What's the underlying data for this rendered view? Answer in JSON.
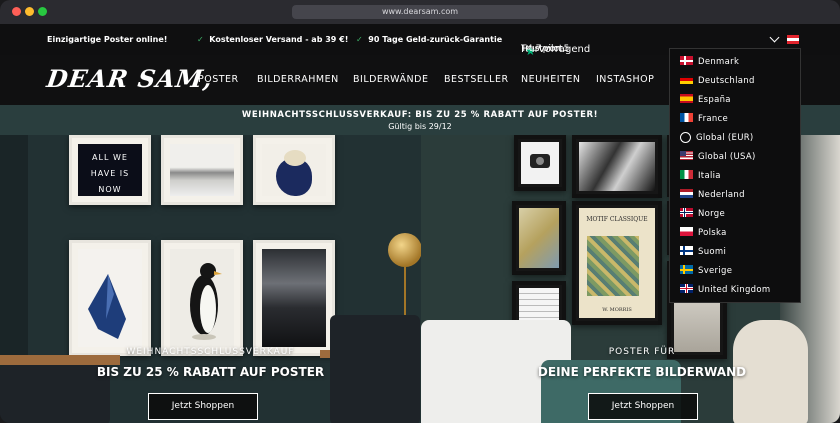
{
  "browser": {
    "url": "www.dearsam.com"
  },
  "topbar": {
    "left": "Einzigartige Poster online!",
    "shipping": "Kostenloser Versand - ab 39 €!",
    "guarantee": "90 Tage Geld-zurück-Garantie",
    "rating_word": "Hervorragend",
    "rating_score": "4.7 von 5",
    "rating_brand": "Trustpilot"
  },
  "nav": {
    "logo": "DEAR SAM,",
    "links": [
      "POSTER",
      "BILDERRAHMEN",
      "BILDERWÄNDE",
      "BESTSELLER",
      "NEUHEITEN",
      "INSTASHOP"
    ]
  },
  "promo": {
    "headline": "WEIHNACHTSSCHLUSSVERKAUF: BIS ZU 25 % RABATT AUF POSTER!",
    "validity": "Gültig bis 29/12"
  },
  "hero_left": {
    "eyebrow": "WEIHNACHTSSCHLUSSVERKAUF",
    "title": "BIS ZU 25 % RABATT AUF POSTER",
    "button": "Jetzt Shoppen",
    "poster_text": "ALL WE HAVE IS NOW"
  },
  "hero_right": {
    "eyebrow": "POSTER FÜR",
    "title": "DEINE PERFEKTE BILDERWAND",
    "button": "Jetzt Shoppen",
    "poster_title": "MOTIF CLASSIQUE",
    "poster_author": "W. MORRIS"
  },
  "countries": [
    {
      "label": "Denmark",
      "icon": "flag-dk"
    },
    {
      "label": "Deutschland",
      "icon": "flag-de"
    },
    {
      "label": "España",
      "icon": "flag-es"
    },
    {
      "label": "France",
      "icon": "flag-fr"
    },
    {
      "label": "Global (EUR)",
      "icon": "globe-icon"
    },
    {
      "label": "Global (USA)",
      "icon": "flag-us"
    },
    {
      "label": "Italia",
      "icon": "flag-it"
    },
    {
      "label": "Nederland",
      "icon": "flag-nl"
    },
    {
      "label": "Norge",
      "icon": "flag-no"
    },
    {
      "label": "Polska",
      "icon": "flag-pl"
    },
    {
      "label": "Suomi",
      "icon": "flag-fi"
    },
    {
      "label": "Sverige",
      "icon": "flag-se"
    },
    {
      "label": "United Kingdom",
      "icon": "flag-gb"
    }
  ],
  "colors": {
    "promo_bg": "#2a3e3e",
    "trustpilot_green": "#00b67a",
    "check_green": "#3fb56a"
  }
}
